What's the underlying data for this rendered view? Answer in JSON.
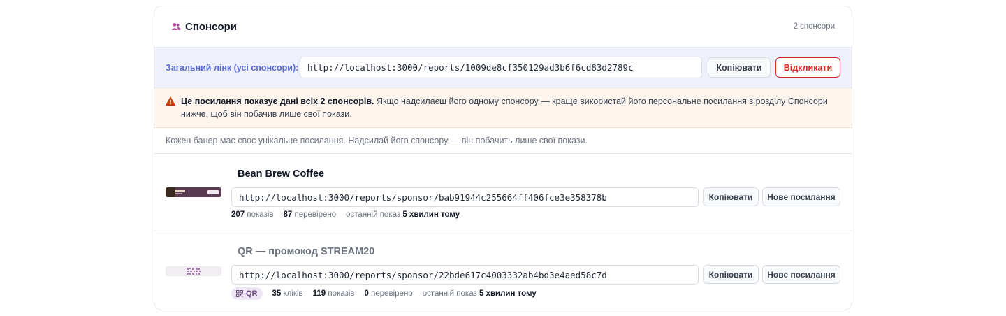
{
  "header": {
    "title": "Спонсори",
    "count": "2 спонсори",
    "icon": "users-icon"
  },
  "general": {
    "label": "Загальний лінк (усі спонсори):",
    "url": "http://localhost:3000/reports/1009de8cf350129ad3b6f6cd83d2789c",
    "copy_label": "Копіювати",
    "revoke_label": "Відкликати"
  },
  "warning": {
    "icon": "warning-triangle-icon",
    "bold": "Це посилання показує дані всіх 2 спонсорів.",
    "text": " Якщо надсилаєш його одному спонсору — краще використай його персональне посилання з розділу Спонсори нижче, щоб він побачив лише свої покази."
  },
  "note": "Кожен банер має своє унікальне посилання. Надсилай його спонсору — він побачить лише свої покази.",
  "banners": [
    {
      "name": "Bean Brew Coffee",
      "url": "http://localhost:3000/reports/sponsor/bab91944c255664ff406fce3e358378b",
      "copy_label": "Копіювати",
      "new_link_label": "Нове посилання",
      "stats": {
        "impressions_value": "207",
        "impressions_label": "показів",
        "verified_value": "87",
        "verified_label": "перевірено",
        "last_label": "останній показ",
        "last_value": "5 хвилин тому"
      },
      "thumb_text": "Bean Brew Coffee"
    },
    {
      "name": "QR — промокод STREAM20",
      "url": "http://localhost:3000/reports/sponsor/22bde617c4003332ab4bd3e4aed58c7d",
      "copy_label": "Копіювати",
      "new_link_label": "Нове посилання",
      "badge": "QR",
      "stats": {
        "clicks_value": "35",
        "clicks_label": "кліків",
        "impressions_value": "119",
        "impressions_label": "показів",
        "verified_value": "0",
        "verified_label": "перевірено",
        "last_label": "останній показ",
        "last_value": "5 хвилин тому"
      }
    }
  ],
  "colors": {
    "accent": "#5b6bd6",
    "danger": "#dc2626",
    "warning": "#c2410c",
    "icon_purple": "#b0479e"
  }
}
